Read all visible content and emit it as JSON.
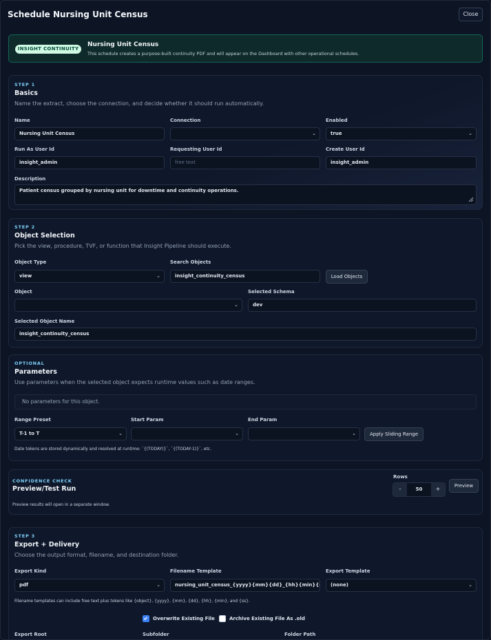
{
  "modal": {
    "title": "Schedule Nursing Unit Census",
    "close_label": "Close"
  },
  "banner": {
    "badge": "INSIGHT CONTINUITY",
    "title": "Nursing Unit Census",
    "description": "This schedule creates a purpose-built continuity PDF and will appear on the Dashboard with other operational schedules."
  },
  "step1": {
    "kicker": "STEP 1",
    "title": "Basics",
    "description": "Name the extract, choose the connection, and decide whether it should run automatically.",
    "name_label": "Name",
    "name_value": "Nursing Unit Census",
    "connection_label": "Connection",
    "connection_value": "",
    "enabled_label": "Enabled",
    "enabled_value": "true",
    "run_as_label": "Run As User Id",
    "run_as_value": "insight_admin",
    "requesting_label": "Requesting User Id",
    "requesting_placeholder": "free text",
    "create_label": "Create User Id",
    "create_value": "insight_admin",
    "description_label": "Description",
    "description_value": "Patient census grouped by nursing unit for downtime and continuity operations."
  },
  "step2": {
    "kicker": "STEP 2",
    "title": "Object Selection",
    "description": "Pick the view, procedure, TVF, or function that Insight Pipeline should execute.",
    "object_type_label": "Object Type",
    "object_type_value": "view",
    "search_label": "Search Objects",
    "search_value": "insight_continuity_census",
    "load_button": "Load Objects",
    "object_label": "Object",
    "object_value": "",
    "schema_label": "Selected Schema",
    "schema_value": "dev",
    "object_name_label": "Selected Object Name",
    "object_name_value": "insight_continuity_census"
  },
  "parameters": {
    "kicker": "OPTIONAL",
    "title": "Parameters",
    "description": "Use parameters when the selected object expects runtime values such as date ranges.",
    "empty_text": "No parameters for this object.",
    "range_label": "Range Preset",
    "range_value": "T-1 to T",
    "start_label": "Start Param",
    "start_value": "",
    "end_label": "End Param",
    "end_value": "",
    "apply_button": "Apply Sliding Range",
    "note": "Date tokens are stored dynamically and resolved at runtime: `{(TODAY)}`, `{(TODAY-1)}`, etc."
  },
  "preview": {
    "kicker": "CONFIDENCE CHECK",
    "title": "Preview/Test Run",
    "note": "Preview results will open in a separate window.",
    "rows_label": "Rows",
    "rows_value": "50",
    "minus": "-",
    "plus": "+",
    "preview_button": "Preview"
  },
  "step3": {
    "kicker": "STEP 3",
    "title": "Export + Delivery",
    "description": "Choose the output format, filename, and destination folder.",
    "export_kind_label": "Export Kind",
    "export_kind_value": "pdf",
    "filename_label": "Filename Template",
    "filename_value": "nursing_unit_census_{yyyy}{mm}{dd}_{hh}{min}{ss}",
    "template_label": "Export Template",
    "template_value": "(none)",
    "filename_note": "Filename templates can include free text plus tokens like {object}, {yyyy}, {mm}, {dd}, {hh}, {min}, and {ss}.",
    "overwrite_label": "Overwrite Existing File",
    "overwrite_checked": true,
    "archive_label": "Archive Existing File As .old",
    "archive_checked": false,
    "export_root_label": "Export Root",
    "subfolder_label": "Subfolder",
    "folder_path_label": "Folder Path"
  },
  "colors": {
    "accent": "#3b82f6",
    "kicker": "#7dd3fc",
    "badge_bg": "#d1fae5",
    "banner_border": "#14655a"
  },
  "icons": {
    "chevron": "chevron-down-icon",
    "resize": "resize-grip-icon",
    "check": "check-icon"
  }
}
